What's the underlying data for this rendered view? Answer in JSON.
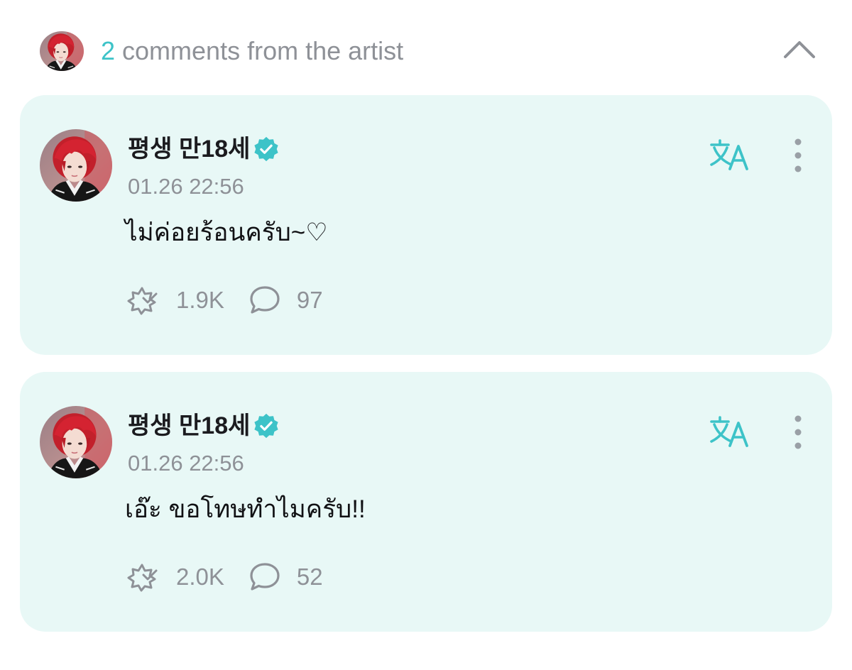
{
  "header": {
    "comment_count": "2",
    "title_suffix": "comments from the artist",
    "avatar_icon": "artist-avatar",
    "collapse_icon": "chevron-up-icon"
  },
  "colors": {
    "accent": "#3dc3c8",
    "card_background": "#e8f8f6",
    "muted_text": "#8e9197",
    "primary_text": "#111114"
  },
  "comments": [
    {
      "author": "평생 만18세",
      "verified": true,
      "timestamp": "01.26 22:56",
      "text": "ไม่ค่อยร้อนครับ~♡",
      "likes": "1.9K",
      "replies": "97",
      "translate_icon": "translate-icon",
      "more_icon": "more-vertical-icon"
    },
    {
      "author": "평생 만18세",
      "verified": true,
      "timestamp": "01.26 22:56",
      "text": "เอ๊ะ ขอโทษทำไมครับ!!",
      "likes": "2.0K",
      "replies": "52",
      "translate_icon": "translate-icon",
      "more_icon": "more-vertical-icon"
    }
  ]
}
